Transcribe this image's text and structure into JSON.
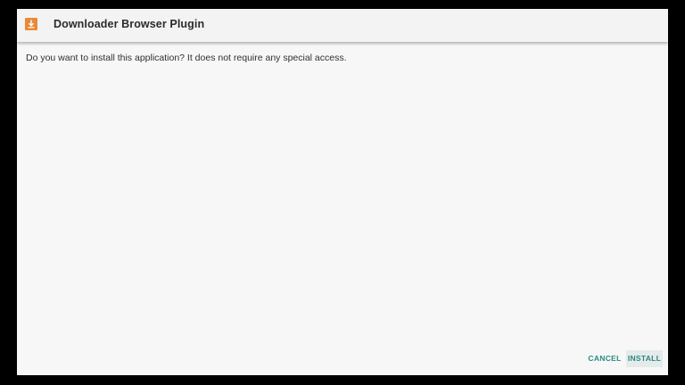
{
  "dialog": {
    "title": "Downloader Browser Plugin",
    "message": "Do you want to install this application? It does not require any special access.",
    "app_icon": "downloader-app-icon",
    "buttons": {
      "cancel_label": "CANCEL",
      "install_label": "INSTALL"
    }
  },
  "colors": {
    "accent": "#2a8a82",
    "icon_orange": "#e88a3a",
    "background": "#f7f7f7",
    "frame_border": "#000000"
  }
}
